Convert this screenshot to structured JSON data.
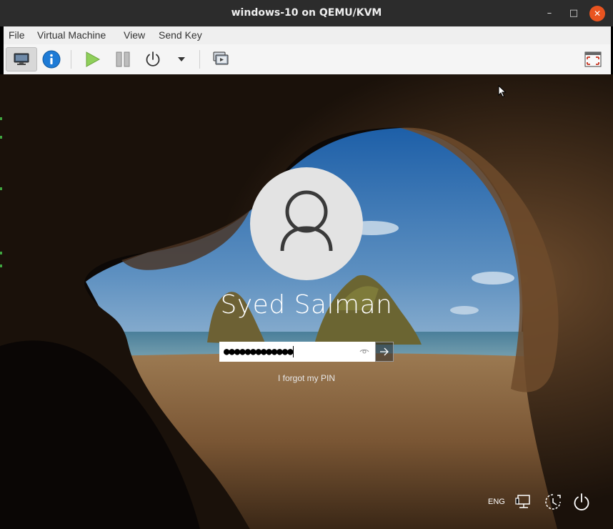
{
  "window": {
    "title": "windows-10 on QEMU/KVM",
    "controls": {
      "minimize": "–",
      "maximize": "□",
      "close": "✕"
    }
  },
  "menu": {
    "items": [
      "File",
      "Virtual Machine",
      "View",
      "Send Key"
    ]
  },
  "toolbar": {
    "buttons": [
      "monitor-icon",
      "info-icon",
      "play-icon",
      "pause-icon",
      "power-icon",
      "dropdown-arrow-icon",
      "snapshots-icon",
      "fullscreen-icon"
    ]
  },
  "login": {
    "user_name": "Syed Salman",
    "pin_masked": "●●●●●●●●●●●●●",
    "forgot_pin_link": "I forgot my PIN"
  },
  "tray": {
    "language": "ENG",
    "icons": [
      "network-icon",
      "ease-of-access-icon",
      "power-icon"
    ]
  },
  "colors": {
    "titlebar": "#2c2c2c",
    "close_button": "#e95420",
    "menubar": "#efefef",
    "info_blue": "#1e7bd6",
    "play_green": "#7ec04d"
  }
}
